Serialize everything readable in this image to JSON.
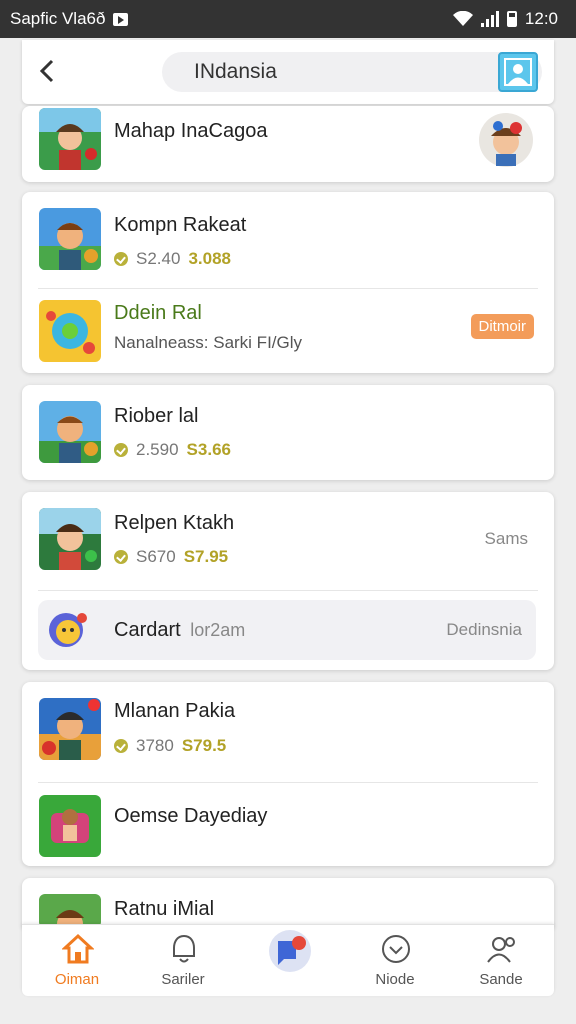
{
  "status_bar": {
    "app_text": "Sapfic Vla6ð",
    "time": "12:0"
  },
  "header": {
    "search_value": "INdansia"
  },
  "cards": [
    {
      "rows": [
        {
          "title": "Mahap InaCagoa"
        }
      ]
    },
    {
      "rows": [
        {
          "title": "Kompn Rakeat",
          "price_old": "S2.40",
          "price_new": "3.088"
        },
        {
          "title": "Ddein Ral",
          "subtitle": "Nanalneass: Sarki FI/Gly",
          "badge": "Ditmoir"
        }
      ]
    },
    {
      "rows": [
        {
          "title": "Riober lal",
          "price_old": "2.590",
          "price_new": "S3.66"
        }
      ]
    },
    {
      "rows": [
        {
          "title": "Relpen Ktakh",
          "price_old": "S670",
          "price_new": "S7.95",
          "right_label": "Sams"
        },
        {
          "title": "Cardart",
          "title_suffix": "lor2am",
          "right_label": "Dedinsnia"
        }
      ]
    },
    {
      "rows": [
        {
          "title": "Mlanan Pakia",
          "price_old": "3780",
          "price_new": "S79.5"
        },
        {
          "title": "Oemse Dayediay"
        }
      ]
    },
    {
      "rows": [
        {
          "title": "Ratnu iMial"
        }
      ]
    }
  ],
  "bottom_nav": [
    {
      "label": "Oiman",
      "icon": "home-icon",
      "active": true
    },
    {
      "label": "Sariler",
      "icon": "bell-icon",
      "active": false
    },
    {
      "label": "",
      "icon": "chat-icon",
      "active": false
    },
    {
      "label": "Niode",
      "icon": "heart-icon",
      "active": false
    },
    {
      "label": "Sande",
      "icon": "people-icon",
      "active": false
    }
  ],
  "colors": {
    "accent": "#f07b20",
    "price": "#b2a227",
    "badge": "#f39c5a",
    "status_bar": "#333333"
  }
}
